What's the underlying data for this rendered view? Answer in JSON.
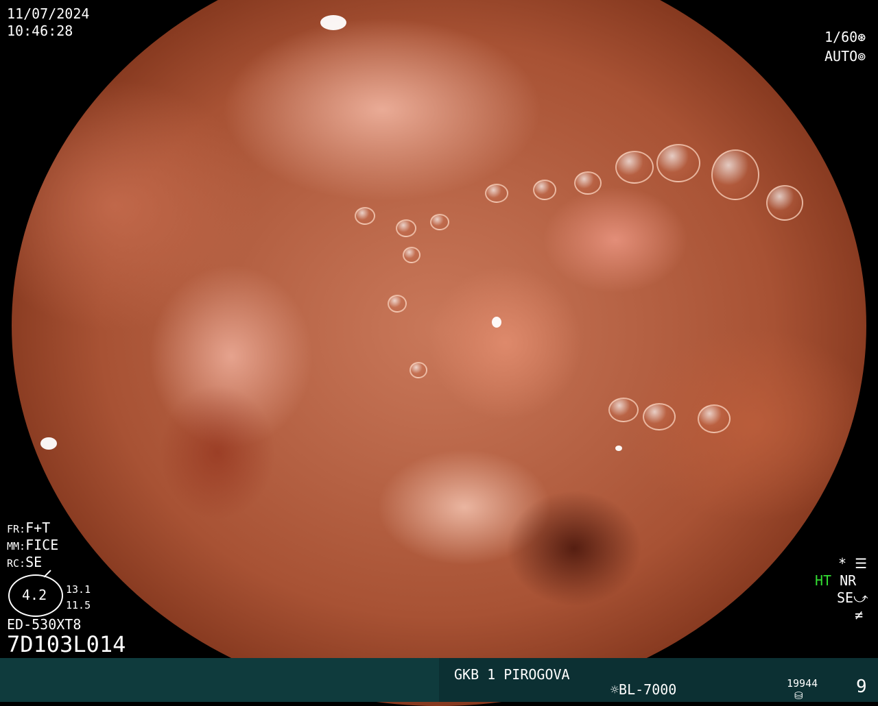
{
  "header": {
    "date": "11/07/2024",
    "time": "10:46:28"
  },
  "camera": {
    "shutter": "1/60",
    "shutter_icon": "aperture-icon",
    "mode": "AUTO",
    "mode_icon": "iris-icon"
  },
  "settings": {
    "fr_label": "FR:",
    "fr_value": "F+T",
    "mm_label": "MM:",
    "mm_value": "FICE",
    "rc_label": "RC:",
    "rc_value": "SE",
    "zoom": "4.2",
    "values": [
      "13.1",
      "11.5"
    ]
  },
  "scope": {
    "model": "ED-530XT8",
    "serial": "7D103L014"
  },
  "right_indicators": {
    "star": "*",
    "star_icon": "settings-sliders-icon",
    "ht": "HT",
    "nr": "NR",
    "se": "SE",
    "se_icon": "curve-icon",
    "bottom_icon": "not-equal-icon",
    "ht_color": "#33dd33"
  },
  "footer": {
    "hospital": "GKB 1 PIROGOVA",
    "light_source": "BL-7000",
    "light_icon": "sun-icon",
    "storage_count": "19944",
    "storage_icon": "disk-stack-icon",
    "page": "9"
  }
}
